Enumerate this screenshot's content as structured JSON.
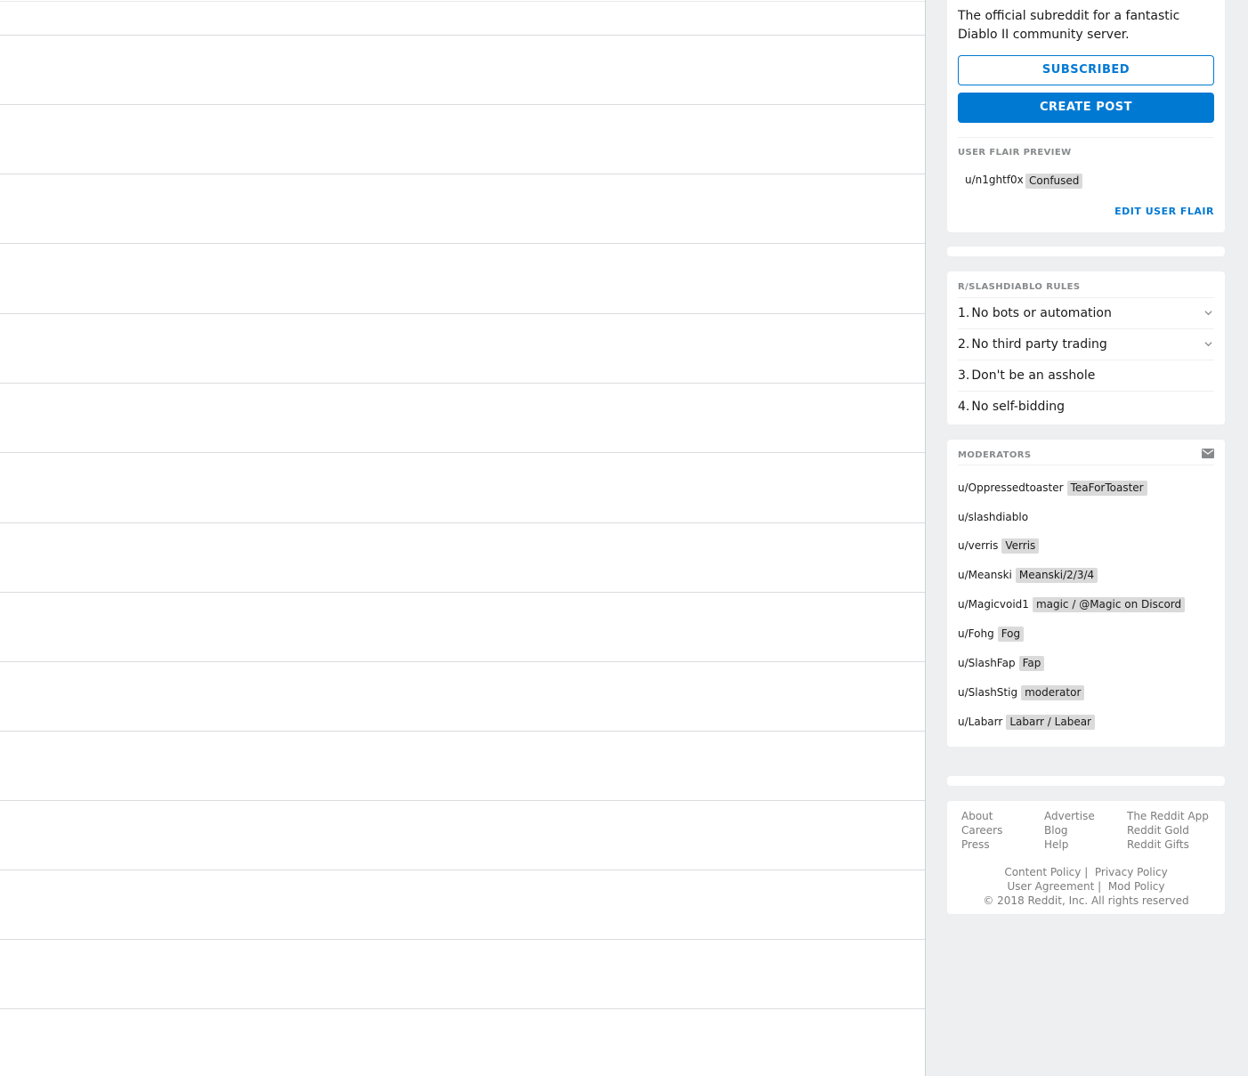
{
  "sidebar": {
    "about": {
      "description": "The official subreddit for a fantastic Diablo II community server.",
      "subscribed_label": "SUBSCRIBED",
      "create_post_label": "CREATE POST",
      "user_flair_preview_label": "USER FLAIR PREVIEW",
      "flair_username": "u/n1ghtf0x",
      "flair_text": "Confused",
      "edit_user_flair_label": "EDIT USER FLAIR"
    },
    "rules": {
      "title": "R/SLASHDIABLO RULES",
      "items": [
        {
          "num": "1.",
          "text": "No bots or automation",
          "expandable": true
        },
        {
          "num": "2.",
          "text": "No third party trading",
          "expandable": true
        },
        {
          "num": "3.",
          "text": "Don't be an asshole",
          "expandable": false
        },
        {
          "num": "4.",
          "text": "No self-bidding",
          "expandable": false
        }
      ]
    },
    "moderators": {
      "title": "MODERATORS",
      "items": [
        {
          "user": "u/Oppressedtoaster",
          "flair": "TeaForToaster"
        },
        {
          "user": "u/slashdiablo",
          "flair": ""
        },
        {
          "user": "u/verris",
          "flair": "Verris"
        },
        {
          "user": "u/Meanski",
          "flair": "Meanski/2/3/4"
        },
        {
          "user": "u/Magicvoid1",
          "flair": "magic / @Magic on Discord"
        },
        {
          "user": "u/Fohg",
          "flair": "Fog"
        },
        {
          "user": "u/SlashFap",
          "flair": "Fap"
        },
        {
          "user": "u/SlashStig",
          "flair": "moderator"
        },
        {
          "user": "u/Labarr",
          "flair": "Labarr / Labear"
        }
      ]
    },
    "footer": {
      "col1": [
        "About",
        "Careers",
        "Press"
      ],
      "col2": [
        "Advertise",
        "Blog",
        "Help"
      ],
      "col3": [
        "The Reddit App",
        "Reddit Gold",
        "Reddit Gifts"
      ],
      "content_policy": "Content Policy",
      "privacy_policy": "Privacy Policy",
      "user_agreement": "User Agreement",
      "mod_policy": "Mod Policy",
      "copyright": "© 2018 Reddit, Inc. All rights reserved"
    }
  },
  "colors": {
    "accent": "#0079d3",
    "background": "#edeff1",
    "flair_bg": "#dadada"
  }
}
